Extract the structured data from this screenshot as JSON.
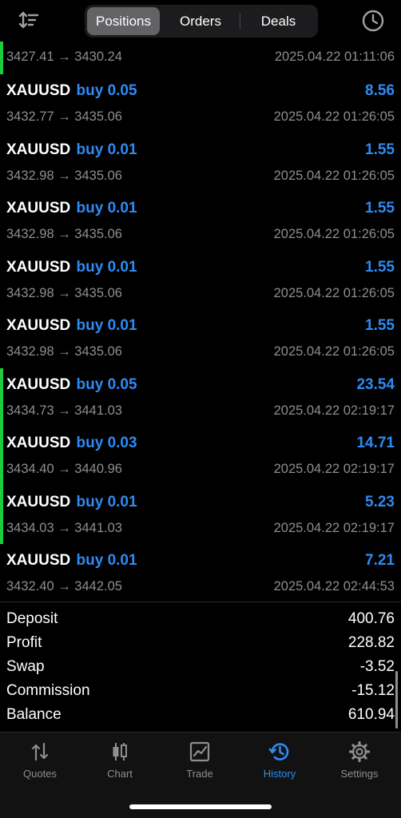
{
  "header": {
    "tabs": [
      {
        "label": "Positions",
        "selected": true
      },
      {
        "label": "Orders",
        "selected": false
      },
      {
        "label": "Deals",
        "selected": false
      }
    ],
    "sort_icon": "sort-icon",
    "history_icon": "clock-icon"
  },
  "deals": [
    {
      "symbol": "",
      "direction": "",
      "profit": "",
      "prices": "3427.41 → 3430.24",
      "time": "2025.04.22 01:11:06",
      "accent": true
    },
    {
      "symbol": "XAUUSD",
      "direction": "buy 0.05",
      "profit": "8.56",
      "prices": "3432.77 → 3435.06",
      "time": "2025.04.22 01:26:05",
      "accent": false
    },
    {
      "symbol": "XAUUSD",
      "direction": "buy 0.01",
      "profit": "1.55",
      "prices": "3432.98 → 3435.06",
      "time": "2025.04.22 01:26:05",
      "accent": false
    },
    {
      "symbol": "XAUUSD",
      "direction": "buy 0.01",
      "profit": "1.55",
      "prices": "3432.98 → 3435.06",
      "time": "2025.04.22 01:26:05",
      "accent": false
    },
    {
      "symbol": "XAUUSD",
      "direction": "buy 0.01",
      "profit": "1.55",
      "prices": "3432.98 → 3435.06",
      "time": "2025.04.22 01:26:05",
      "accent": false
    },
    {
      "symbol": "XAUUSD",
      "direction": "buy 0.01",
      "profit": "1.55",
      "prices": "3432.98 → 3435.06",
      "time": "2025.04.22 01:26:05",
      "accent": false
    },
    {
      "symbol": "XAUUSD",
      "direction": "buy 0.05",
      "profit": "23.54",
      "prices": "3434.73 → 3441.03",
      "time": "2025.04.22 02:19:17",
      "accent": true
    },
    {
      "symbol": "XAUUSD",
      "direction": "buy 0.03",
      "profit": "14.71",
      "prices": "3434.40 → 3440.96",
      "time": "2025.04.22 02:19:17",
      "accent": true
    },
    {
      "symbol": "XAUUSD",
      "direction": "buy 0.01",
      "profit": "5.23",
      "prices": "3434.03 → 3441.03",
      "time": "2025.04.22 02:19:17",
      "accent": true
    },
    {
      "symbol": "XAUUSD",
      "direction": "buy 0.01",
      "profit": "7.21",
      "prices": "3432.40 → 3442.05",
      "time": "2025.04.22 02:44:53",
      "accent": false
    }
  ],
  "summary": [
    {
      "label": "Deposit",
      "value": "400.76"
    },
    {
      "label": "Profit",
      "value": "228.82"
    },
    {
      "label": "Swap",
      "value": "-3.52"
    },
    {
      "label": "Commission",
      "value": "-15.12"
    },
    {
      "label": "Balance",
      "value": "610.94"
    }
  ],
  "tabbar": [
    {
      "label": "Quotes",
      "icon": "quotes-icon",
      "active": false
    },
    {
      "label": "Chart",
      "icon": "candlestick-chart-icon",
      "active": false
    },
    {
      "label": "Trade",
      "icon": "trade-chart-icon",
      "active": false
    },
    {
      "label": "History",
      "icon": "history-icon",
      "active": true
    },
    {
      "label": "Settings",
      "icon": "gear-icon",
      "active": false
    }
  ],
  "colors": {
    "background": "#000000",
    "accent_blue": "#2f8bf2",
    "accent_green": "#1ecb3c",
    "secondary_text": "#8e8e93",
    "segment_selected": "#636366"
  }
}
